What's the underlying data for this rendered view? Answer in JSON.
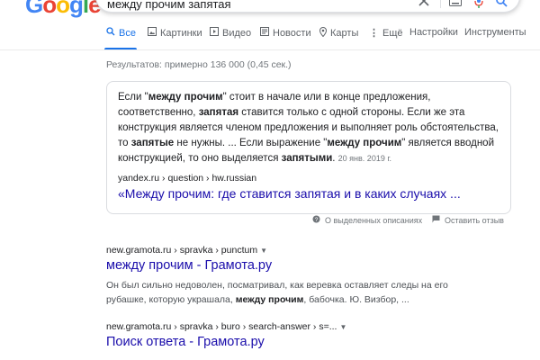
{
  "logo": [
    "G",
    "o",
    "o",
    "g",
    "l",
    "e"
  ],
  "logo_colors": [
    "#4285f4",
    "#ea4335",
    "#fbbc05",
    "#4285f4",
    "#34a853",
    "#ea4335"
  ],
  "search": {
    "query": "между прочим запятая"
  },
  "icons": {
    "clear": "close-icon",
    "keyboard": "keyboard-icon",
    "voice": "microphone-icon",
    "search": "search-icon"
  },
  "tabs": [
    {
      "label": "Все",
      "icon": "search-icon",
      "active": true
    },
    {
      "label": "Картинки",
      "icon": "image-icon"
    },
    {
      "label": "Видео",
      "icon": "video-icon"
    },
    {
      "label": "Новости",
      "icon": "news-icon"
    },
    {
      "label": "Карты",
      "icon": "map-pin-icon"
    },
    {
      "label": "Ещё",
      "icon": "more-vert-icon"
    },
    {
      "label": "Настройки"
    },
    {
      "label": "Инструменты"
    }
  ],
  "stats": "Результатов: примерно 136 000 (0,45 сек.)",
  "snippet": {
    "p1": "Если \"",
    "b1": "между прочим",
    "p2": "\" стоит в начале или в конце предложения, соответственно, ",
    "b2": "запятая",
    "p3": " ставится только с одной стороны. Если же эта конструкция является членом предложения и выполняет роль обстоятельства, то ",
    "b3": "запятые",
    "p4": " не нужны. ... Если выражение \"",
    "b4": "между прочим",
    "p5": "\" является вводной конструкцией, то оно выделяется ",
    "b5": "запятыми",
    "p6": ". ",
    "date": "20 янв. 2019 г.",
    "cite": "yandex.ru › question › hw.russian",
    "link": "«Между прочим: где ставится запятая и в каких случаях ..."
  },
  "feedback": {
    "about": "О выделенных описаниях",
    "report": "Оставить отзыв"
  },
  "results": [
    {
      "cite": "new.gramota.ru › spravka › punctum",
      "title": "между прочим - Грамота.ру",
      "d1": "Он был сильно недоволен, посматривал, как веревка оставляет следы на его рубашке, которую украшала, ",
      "db": "между прочим",
      "d2": ", бабочка. Ю. Визбор, ..."
    },
    {
      "cite": "new.gramota.ru › spravka › buro › search-answer › s=...",
      "title": "Поиск ответа - Грамота.ру",
      "d1": "",
      "db": "",
      "d2": ""
    }
  ]
}
